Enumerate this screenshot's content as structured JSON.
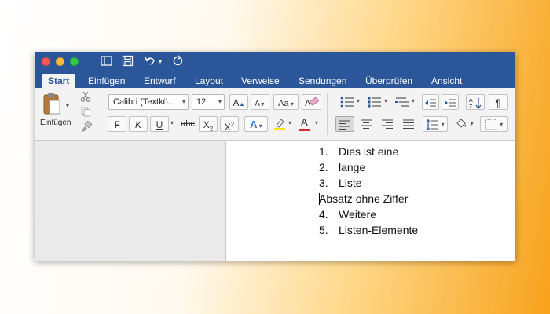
{
  "tabs": [
    {
      "label": "Start",
      "active": true
    },
    {
      "label": "Einfügen",
      "active": false
    },
    {
      "label": "Entwurf",
      "active": false
    },
    {
      "label": "Layout",
      "active": false
    },
    {
      "label": "Verweise",
      "active": false
    },
    {
      "label": "Sendungen",
      "active": false
    },
    {
      "label": "Überprüfen",
      "active": false
    },
    {
      "label": "Ansicht",
      "active": false
    }
  ],
  "ribbon": {
    "paste_label": "Einfügen",
    "font_name": "Calibri (Textkö...",
    "font_size": "12",
    "bold": "F",
    "italic": "K",
    "underline": "U",
    "strikethrough": "abc",
    "subscript": "X",
    "subscript_mark": "2",
    "superscript": "X",
    "superscript_mark": "2",
    "grow_font": "A",
    "shrink_font": "A",
    "change_case": "Aa",
    "highlight_color": "#f5e400",
    "font_color": "#d22b2b",
    "paragraph_mark": "¶"
  },
  "document": {
    "items": [
      {
        "number": "1.",
        "text": "Dies ist eine"
      },
      {
        "number": "2.",
        "text": "lange"
      },
      {
        "number": "3.",
        "text": "Liste"
      },
      {
        "number": "",
        "text": "Absatz ohne Ziffer"
      },
      {
        "number": "4.",
        "text": "Weitere"
      },
      {
        "number": "5.",
        "text": "Listen-Elemente"
      }
    ]
  },
  "colors": {
    "title_bar": "#2b579a",
    "ribbon_bg": "#f3f3f3"
  }
}
